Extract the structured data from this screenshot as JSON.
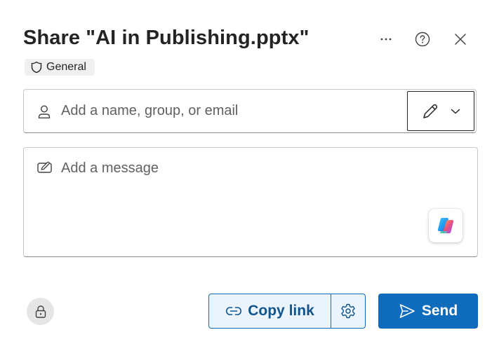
{
  "dialog": {
    "title": "Share \"AI in Publishing.pptx\"",
    "sensitivity_label": "General"
  },
  "header_icons": {
    "more": "more-horizontal-icon",
    "help": "question-circle-icon",
    "close": "dismiss-icon"
  },
  "recipients": {
    "placeholder": "Add a name, group, or email",
    "value": "",
    "permission_icon": "pencil-edit-icon"
  },
  "message": {
    "placeholder": "Add a message",
    "value": ""
  },
  "footer": {
    "copy_link_label": "Copy link",
    "send_label": "Send"
  },
  "colors": {
    "accent": "#0f6cbd",
    "accent_light": "#ebf3fc",
    "text": "#242424",
    "placeholder": "#616161"
  }
}
